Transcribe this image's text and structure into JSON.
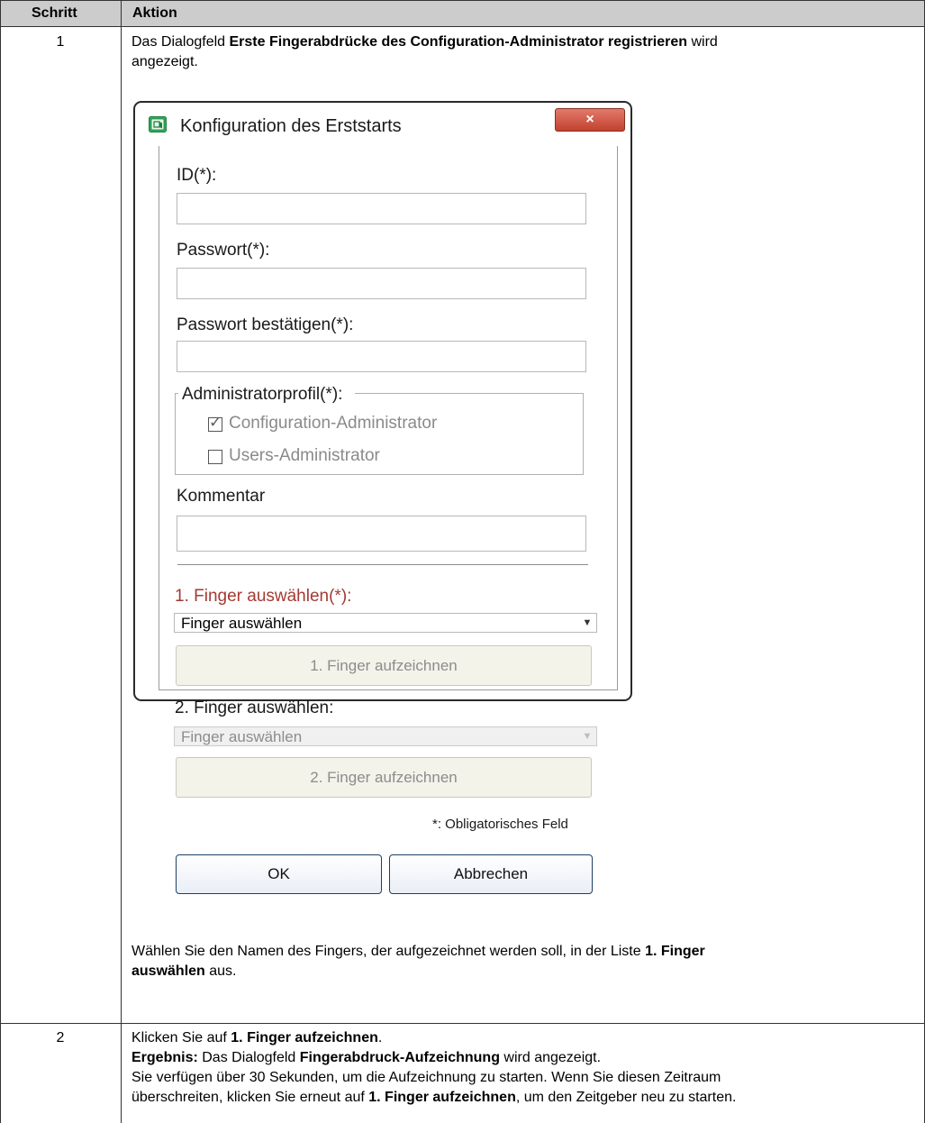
{
  "table": {
    "col_step": "Schritt",
    "col_action": "Aktion",
    "rows": [
      {
        "step": "1",
        "intro_1": "Das Dialogfeld ",
        "intro_bold": "Erste Fingerabdrücke des Configuration-Administrator registrieren",
        "intro_2": " wird",
        "intro_line2": "angezeigt.",
        "after_1": "Wählen Sie den Namen des Fingers, der aufgezeichnet werden soll, in der Liste ",
        "after_bold_1": "1. Finger",
        "after_bold_2": "auswählen",
        "after_2": " aus."
      },
      {
        "step": "2",
        "l1_a": "Klicken Sie auf ",
        "l1_b": "1. Finger aufzeichnen",
        "l1_c": ".",
        "l2_a": "Ergebnis:",
        "l2_b": " Das Dialogfeld ",
        "l2_c": "Fingerabdruck-Aufzeichnung",
        "l2_d": " wird angezeigt.",
        "l3": "Sie verfügen über 30 Sekunden, um die Aufzeichnung zu starten. Wenn Sie diesen Zeitraum",
        "l4_a": "überschreiten, klicken Sie erneut auf ",
        "l4_b": "1. Finger aufzeichnen",
        "l4_c": ", um den Zeitgeber neu zu starten."
      }
    ]
  },
  "dialog": {
    "title": "Konfiguration des Erststarts",
    "close_label": "×",
    "id_label": "ID(*):",
    "id_value": "",
    "password_label": "Passwort(*):",
    "password_value": "",
    "password_confirm_label": "Passwort bestätigen(*):",
    "password_confirm_value": "",
    "profile_group": "Administratorprofil(*):",
    "profile_config_admin": "Configuration-Administrator",
    "profile_config_admin_checked": true,
    "profile_users_admin": "Users-Administrator",
    "profile_users_admin_checked": false,
    "comment_label": "Kommentar",
    "comment_value": "",
    "finger1_label": "1. Finger auswählen(*):",
    "finger1_select": "Finger auswählen",
    "finger1_record": "1. Finger aufzeichnen",
    "finger2_label": "2. Finger auswählen:",
    "finger2_select": "Finger auswählen",
    "finger2_record": "2. Finger aufzeichnen",
    "mandatory_note": "*: Obligatorisches Feld",
    "ok_label": "OK",
    "cancel_label": "Abbrechen",
    "required_color": "#a33a34",
    "close_color": "#c9503f"
  }
}
